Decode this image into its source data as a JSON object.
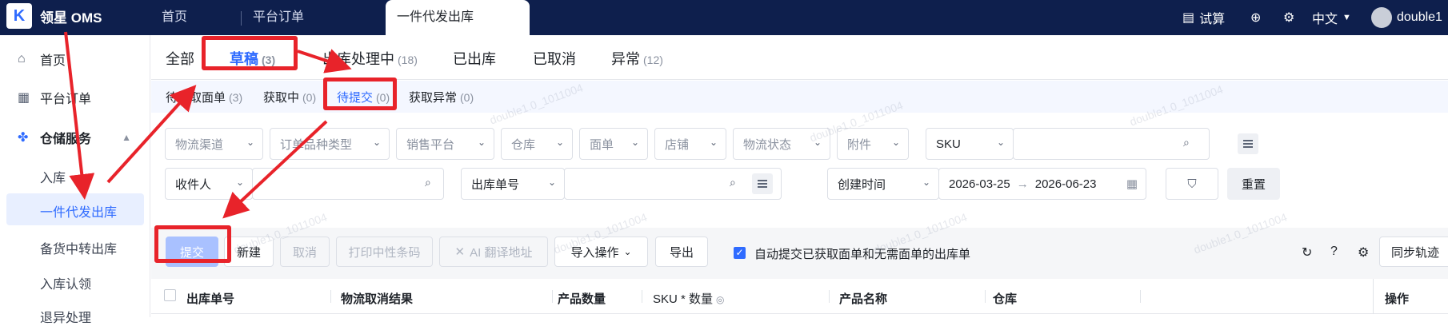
{
  "app": {
    "logo_mark": "K",
    "logo_text": "领星 OMS"
  },
  "top_tabs": [
    "首页",
    "平台订单",
    "一件代发出库"
  ],
  "top_right": {
    "trial": "试算",
    "language": "中文",
    "username": "double1"
  },
  "sidebar": {
    "home": "首页",
    "platform_orders": "平台订单",
    "warehouse_service": "仓储服务",
    "sub_items": [
      "入库",
      "一件代发出库",
      "备货中转出库",
      "入库认领",
      "退异处理"
    ]
  },
  "status_tabs": [
    {
      "label": "全部",
      "count": ""
    },
    {
      "label": "草稿",
      "count": "(3)"
    },
    {
      "label": "出库处理中",
      "count": "(18)"
    },
    {
      "label": "已出库",
      "count": ""
    },
    {
      "label": "已取消",
      "count": ""
    },
    {
      "label": "异常",
      "count": "(12)"
    }
  ],
  "sub_tabs": [
    {
      "label": "待获取面单",
      "count": "(3)"
    },
    {
      "label": "获取中",
      "count": "(0)"
    },
    {
      "label": "待提交",
      "count": "(0)"
    },
    {
      "label": "获取异常",
      "count": "(0)"
    }
  ],
  "filters_row1": [
    "物流渠道",
    "订单品种类型",
    "销售平台",
    "仓库",
    "面单",
    "店铺",
    "物流状态",
    "附件"
  ],
  "filters_row1_sku": "SKU",
  "filters_row2": {
    "recipient": "收件人",
    "order_no": "出库单号",
    "time_type": "创建时间",
    "date_start": "2026-03-25",
    "date_end": "2026-06-23",
    "reset": "重置"
  },
  "toolbar": {
    "submit": "提交",
    "new": "新建",
    "cancel": "取消",
    "print": "打印中性条码",
    "ai_translate": "AI 翻译地址",
    "import": "导入操作",
    "export": "导出",
    "auto_submit": "自动提交已获取面单和无需面单的出库单",
    "sync": "同步轨迹"
  },
  "table_headers": [
    "出库单号",
    "物流取消结果",
    "产品数量",
    "SKU * 数量",
    "产品名称",
    "仓库",
    "操作"
  ],
  "watermark": "double1.0_1011004",
  "colors": {
    "topbar": "#0e1f4d",
    "accent": "#2f6bff",
    "annotation": "#e8232a"
  }
}
